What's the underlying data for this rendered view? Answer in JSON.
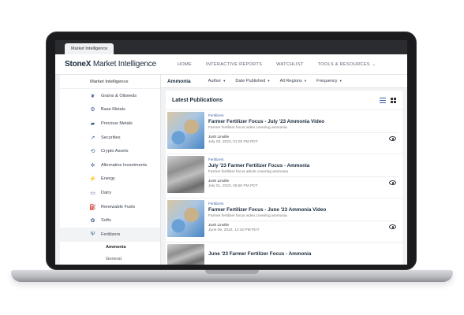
{
  "browser": {
    "tab_label": "Market Intelligence"
  },
  "header": {
    "logo_brand": "StoneX",
    "logo_product": " Market Intelligence",
    "nav": [
      {
        "label": "HOME"
      },
      {
        "label": "INTERACTIVE REPORTS"
      },
      {
        "label": "WATCHLIST"
      },
      {
        "label": "TOOLS & RESOURCES"
      }
    ]
  },
  "sidebar": {
    "heading": "Market Intelligence",
    "items": [
      {
        "label": "Grains & Oilseeds",
        "icon": "wheat-icon"
      },
      {
        "label": "Base Metals",
        "icon": "metal-icon"
      },
      {
        "label": "Precious Metals",
        "icon": "gold-bars-icon"
      },
      {
        "label": "Securities",
        "icon": "trend-icon"
      },
      {
        "label": "Crypto Assets",
        "icon": "crypto-icon"
      },
      {
        "label": "Alternative Investments",
        "icon": "gear-icon"
      },
      {
        "label": "Energy",
        "icon": "energy-icon"
      },
      {
        "label": "Dairy",
        "icon": "dairy-icon"
      },
      {
        "label": "Renewable Fuels",
        "icon": "fuel-icon"
      },
      {
        "label": "Softs",
        "icon": "softs-icon"
      },
      {
        "label": "Fertilizers",
        "icon": "plant-icon"
      }
    ],
    "sub_items": [
      {
        "label": "Ammonia"
      },
      {
        "label": "General"
      }
    ]
  },
  "filters": {
    "title": "Ammonia",
    "items": [
      {
        "label": "Author"
      },
      {
        "label": "Date Published"
      },
      {
        "label": "All Regions"
      },
      {
        "label": "Frequency"
      }
    ]
  },
  "publications": {
    "heading": "Latest Publications",
    "cards": [
      {
        "category": "Fertilizers",
        "title": "Farmer Fertilizer Focus - July '23 Ammonia Video",
        "description": "Farmer fertilizer focus video covering ammonia",
        "author": "Josh Linville",
        "date": "July 03, 2023, 01:03 PM PDT"
      },
      {
        "category": "Fertilizers",
        "title": "July '23 Farmer Fertilizer Focus - Ammonia",
        "description": "Farmer fertilizer focus article covering ammonia",
        "author": "Josh Linville",
        "date": "July 01, 2023, 05:50 PM PDT"
      },
      {
        "category": "Fertilizers",
        "title": "Farmer Fertilizer Focus - June '23 Ammonia Video",
        "description": "Farmer fertilizer focus video covering ammonia",
        "author": "Josh Linville",
        "date": "June 06, 2023, 12:42 PM PDT"
      },
      {
        "category": "",
        "title": "June '23 Farmer Fertilizer Focus - Ammonia",
        "description": "",
        "author": "",
        "date": ""
      }
    ]
  }
}
